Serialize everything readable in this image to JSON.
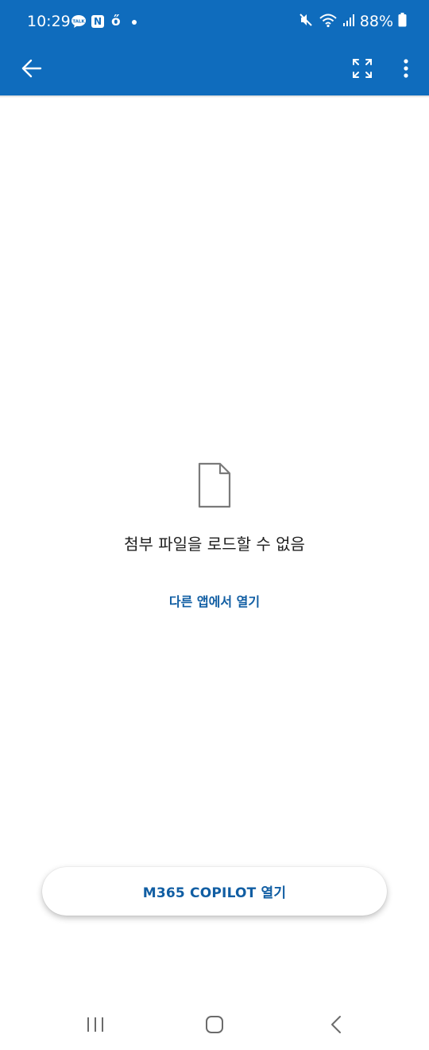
{
  "status_bar": {
    "time": "10:29",
    "battery": "88%",
    "notifications": {
      "talk_icon": "kakaotalk-icon",
      "naver_label": "N",
      "s_glyph": "ő"
    },
    "icons": [
      "mute-icon",
      "wifi-icon",
      "signal-icon",
      "battery-icon"
    ]
  },
  "app_bar": {
    "back_icon": "arrow-back-icon",
    "expand_icon": "fullscreen-icon",
    "more_icon": "more-vertical-icon",
    "background_color": "#0f6cbd"
  },
  "empty_state": {
    "icon": "document-icon",
    "message": "첨부 파일을 로드할 수 없음",
    "link_label": "다른 앱에서 열기"
  },
  "copilot_button": {
    "label": "M365 COPILOT 열기"
  },
  "nav_bar": {
    "recents_icon": "recents-icon",
    "home_icon": "home-icon",
    "back_icon": "nav-back-icon"
  }
}
